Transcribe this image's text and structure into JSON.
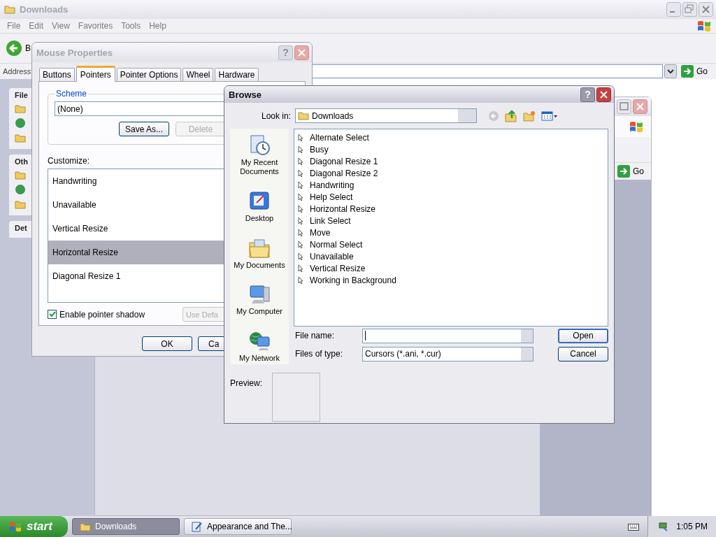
{
  "explorer": {
    "title": "Downloads",
    "active": false,
    "menu": [
      "File",
      "Edit",
      "View",
      "Favorites",
      "Tools",
      "Help"
    ],
    "back_button": "B",
    "address_label": "Address",
    "go_button": "Go",
    "task_pane": [
      {
        "title": "File",
        "icons": [
          {
            "kind": "folder"
          },
          {
            "kind": "globe"
          },
          {
            "kind": "folder"
          }
        ]
      },
      {
        "title": "Oth",
        "icons": [
          {
            "kind": "folder"
          },
          {
            "kind": "globe"
          },
          {
            "kind": "folder"
          }
        ]
      },
      {
        "title": "Det"
      }
    ]
  },
  "second_window": {
    "go_button": "Go"
  },
  "mouse_properties": {
    "title": "Mouse Properties",
    "active": false,
    "help_label": "?",
    "tabs": [
      {
        "label": "Buttons",
        "selected": false
      },
      {
        "label": "Pointers",
        "selected": true
      },
      {
        "label": "Pointer Options",
        "selected": false
      },
      {
        "label": "Wheel",
        "selected": false
      },
      {
        "label": "Hardware",
        "selected": false
      }
    ],
    "scheme_label": "Scheme",
    "scheme_value": "(None)",
    "save_as_button": {
      "label": "Save As...",
      "disabled": false
    },
    "delete_button": {
      "label": "Delete",
      "disabled": true
    },
    "customize_label": "Customize:",
    "pointers": [
      {
        "name": "Handwriting",
        "selected": false
      },
      {
        "name": "Unavailable",
        "selected": false
      },
      {
        "name": "Vertical Resize",
        "selected": false
      },
      {
        "name": "Horizontal Resize",
        "selected": true
      },
      {
        "name": "Diagonal Resize 1",
        "selected": false
      }
    ],
    "shadow": {
      "label": "Enable pointer shadow",
      "checked": true
    },
    "use_default_button": {
      "label": "Use Defa",
      "disabled": true
    },
    "ok_button": "OK",
    "cancel_button": "Ca"
  },
  "browse": {
    "title": "Browse",
    "active": true,
    "help_label": "?",
    "look_in_label": "Look in:",
    "look_in_value": "Downloads",
    "places": [
      {
        "label": "My Recent Documents",
        "kind": "recent"
      },
      {
        "label": "Desktop",
        "kind": "desktop"
      },
      {
        "label": "My Documents",
        "kind": "documents"
      },
      {
        "label": "My Computer",
        "kind": "computer"
      },
      {
        "label": "My Network",
        "kind": "network"
      }
    ],
    "files": [
      {
        "name": "Alternate Select"
      },
      {
        "name": "Busy"
      },
      {
        "name": "Diagonal Resize 1"
      },
      {
        "name": "Diagonal Resize 2"
      },
      {
        "name": "Handwriting"
      },
      {
        "name": "Help Select"
      },
      {
        "name": "Horizontal Resize"
      },
      {
        "name": "Link Select"
      },
      {
        "name": "Move"
      },
      {
        "name": "Normal Select"
      },
      {
        "name": "Unavailable"
      },
      {
        "name": "Vertical Resize"
      },
      {
        "name": "Working in Background"
      }
    ],
    "file_name_label": "File name:",
    "files_of_type_label": "Files of type:",
    "files_of_type_value": "Cursors (*.ani, *.cur)",
    "open_button": "Open",
    "cancel_button": "Cancel",
    "preview_label": "Preview:"
  },
  "taskbar": {
    "start": "start",
    "tasks": [
      {
        "label": "Downloads",
        "kind": "folder",
        "selected": true
      },
      {
        "label": "Appearance and The...",
        "kind": "control",
        "selected": false
      }
    ],
    "clock": "1:05 PM"
  }
}
